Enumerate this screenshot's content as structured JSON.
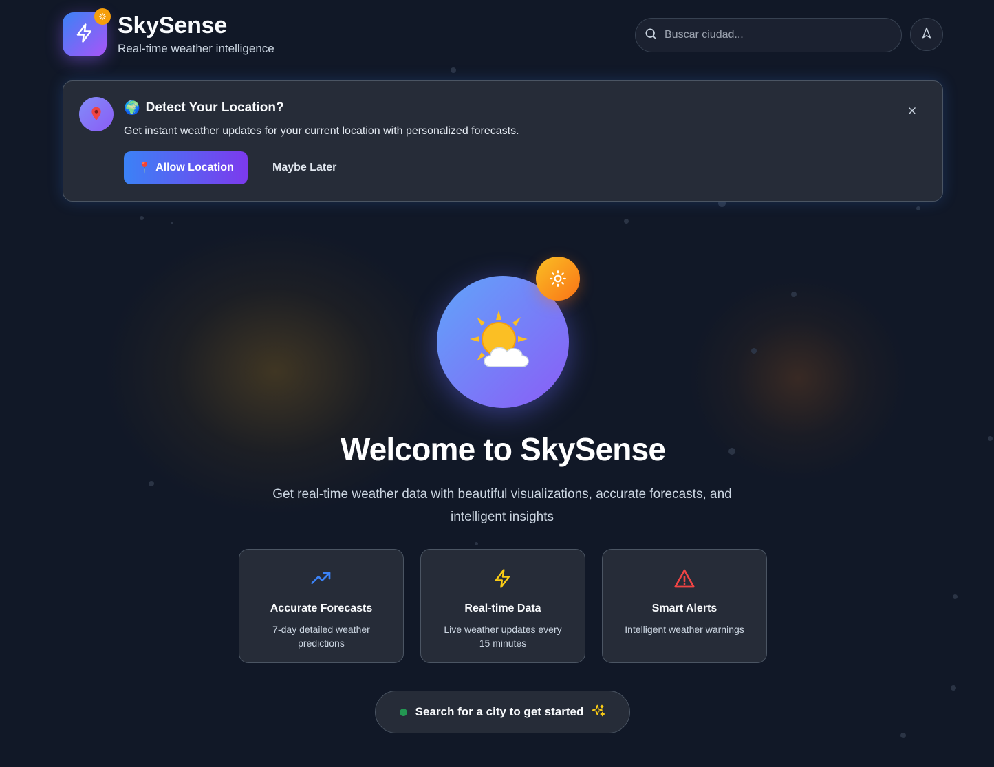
{
  "header": {
    "app_title": "SkySense",
    "app_subtitle": "Real-time weather intelligence",
    "logo_icon": "bolt-icon",
    "search_placeholder": "Buscar ciudad...",
    "nav_icon": "navigation-arrow-icon"
  },
  "location_banner": {
    "emoji": "🌍",
    "title": "Detect Your Location?",
    "description": "Get instant weather updates for your current location with personalized forecasts.",
    "allow_emoji": "📍",
    "allow_label": "Allow Location",
    "later_label": "Maybe Later"
  },
  "hero": {
    "emoji": "🌤️",
    "title": "Welcome to SkySense",
    "subtitle": "Get real-time weather data with beautiful visualizations, accurate forecasts, and intelligent insights"
  },
  "features": [
    {
      "icon": "trending-up-icon",
      "title": "Accurate Forecasts",
      "description": "7-day detailed weather predictions",
      "color": "#3b82f6"
    },
    {
      "icon": "bolt-icon",
      "title": "Real-time Data",
      "description": "Live weather updates every 15 minutes",
      "color": "#facc15"
    },
    {
      "icon": "alert-triangle-icon",
      "title": "Smart Alerts",
      "description": "Intelligent weather warnings",
      "color": "#ef4444"
    }
  ],
  "cta": {
    "label": "Search for a city to get started",
    "status_color": "#22c55e",
    "icon": "sparkles-icon"
  },
  "colors": {
    "background": "#111827",
    "accent_blue": "#3b82f6",
    "accent_purple": "#8b5cf6",
    "accent_orange": "#f97316"
  }
}
